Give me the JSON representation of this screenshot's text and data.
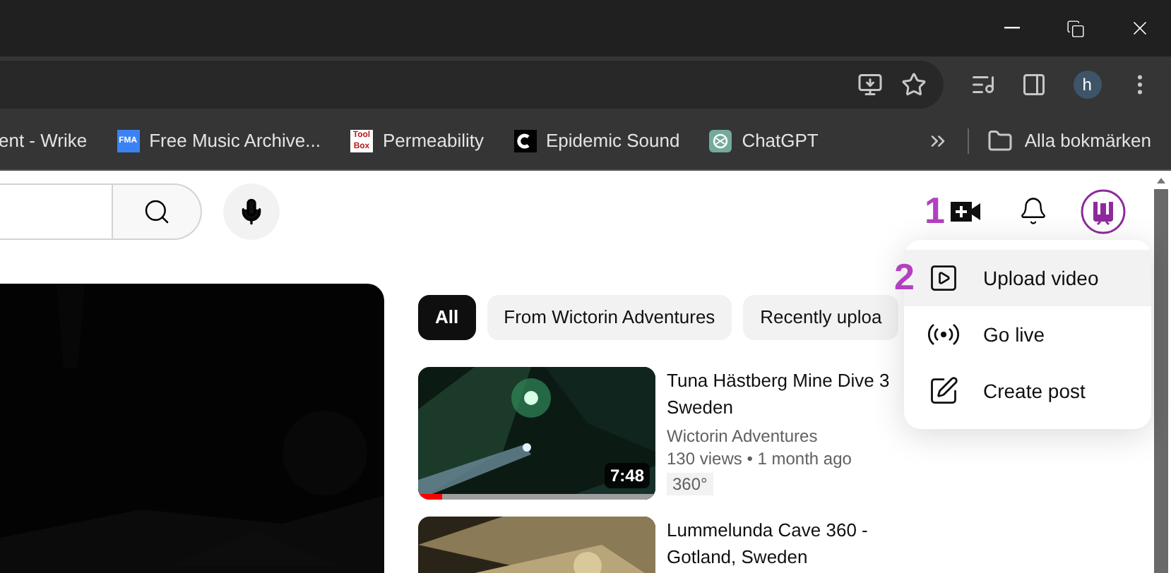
{
  "toolbar": {
    "profile_initial": "h"
  },
  "bookmarks": [
    {
      "label": "ent - Wrike",
      "kind": "none"
    },
    {
      "label": "Free Music Archive...",
      "kind": "fma",
      "icon_text": "FMA"
    },
    {
      "label": "Permeability",
      "kind": "toolbox",
      "icon_text": "Tool Box"
    },
    {
      "label": "Epidemic Sound",
      "kind": "epidemic"
    },
    {
      "label": "ChatGPT",
      "kind": "chatgpt"
    }
  ],
  "all_bookmarks": "Alla bokmärken",
  "annotations": [
    "1",
    "2"
  ],
  "chips": [
    {
      "label": "All",
      "selected": true
    },
    {
      "label": "From Wictorin Adventures",
      "selected": false
    },
    {
      "label": "Recently uploa",
      "selected": false
    }
  ],
  "create_menu": [
    {
      "label": "Upload video",
      "kind": "upload",
      "selected": true
    },
    {
      "label": "Go live",
      "kind": "live",
      "selected": false
    },
    {
      "label": "Create post",
      "kind": "post",
      "selected": false
    }
  ],
  "videos": [
    {
      "title_lines": [
        "Tuna Hästberg Mine Dive 3",
        "Sweden"
      ],
      "channel": "Wictorin Adventures",
      "meta": "130 views • 1 month ago",
      "badge": "360°",
      "duration": "7:48",
      "level": 0.1,
      "kind": "green"
    },
    {
      "title_lines": [
        "Lummelunda Cave 360 -",
        "Gotland, Sweden"
      ],
      "kind": "sand"
    }
  ]
}
